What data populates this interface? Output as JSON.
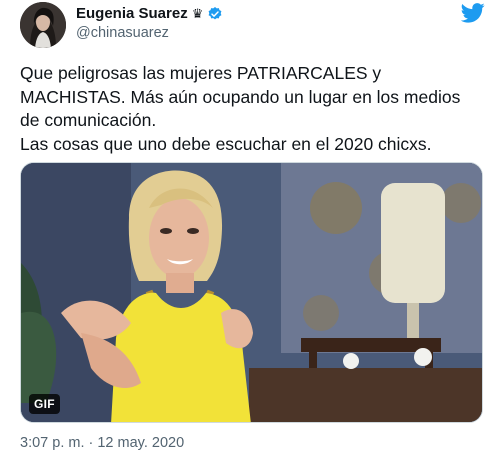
{
  "author": {
    "display_name": "Eugenia Suarez",
    "handle": "@chinasuarez",
    "badge_icon": "crown-icon",
    "verified_icon": "verified-badge-icon",
    "avatar_icon": "avatar"
  },
  "brand": {
    "logo_icon": "twitter-bird-icon",
    "accent": "#1d9bf0"
  },
  "tweet": {
    "lines": [
      "Que peligrosas las mujeres PATRIARCALES y",
      "MACHISTAS. Más aún ocupando un lugar en los medios",
      "de comunicación.",
      "Las cosas que uno debe escuchar en el 2020 chicxs."
    ]
  },
  "media": {
    "badge": "GIF"
  },
  "meta": {
    "timestamp": "3:07 p. m. · 12 may. 2020"
  },
  "colors": {
    "text": "#0f1419",
    "muted": "#536471",
    "verified": "#1d9bf0"
  }
}
